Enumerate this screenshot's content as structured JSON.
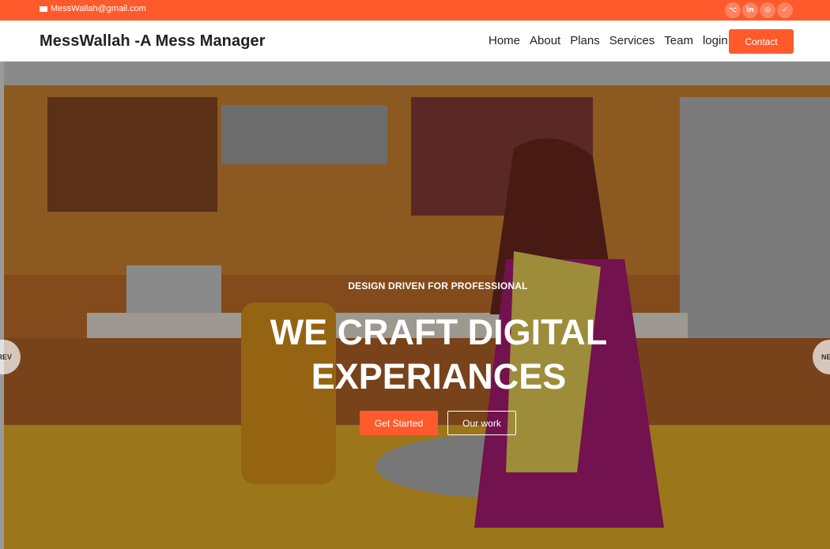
{
  "topbar": {
    "email": "MessWallah@gmail.com",
    "socials": [
      {
        "icon": "github-icon",
        "glyph": "⌥"
      },
      {
        "icon": "linkedin-icon",
        "glyph": "in"
      },
      {
        "icon": "instagram-icon",
        "glyph": "◎"
      },
      {
        "icon": "twitter-icon",
        "glyph": "✓"
      }
    ]
  },
  "navbar": {
    "brand": "MessWallah -A Mess Manager",
    "links": [
      "Home",
      "About",
      "Plans",
      "Services",
      "Team",
      "login"
    ],
    "contact": "Contact"
  },
  "hero": {
    "eyebrow": "DESIGN DRIVEN FOR PROFESSIONAL",
    "headline_line1": "WE CRAFT DIGITAL",
    "headline_line2": "EXPERIANCES",
    "primary_button": "Get Started",
    "secondary_button": "Our work",
    "prev": "PREV",
    "next": "NEXT"
  },
  "colors": {
    "accent": "#ff5a2c",
    "text": "#222222"
  }
}
